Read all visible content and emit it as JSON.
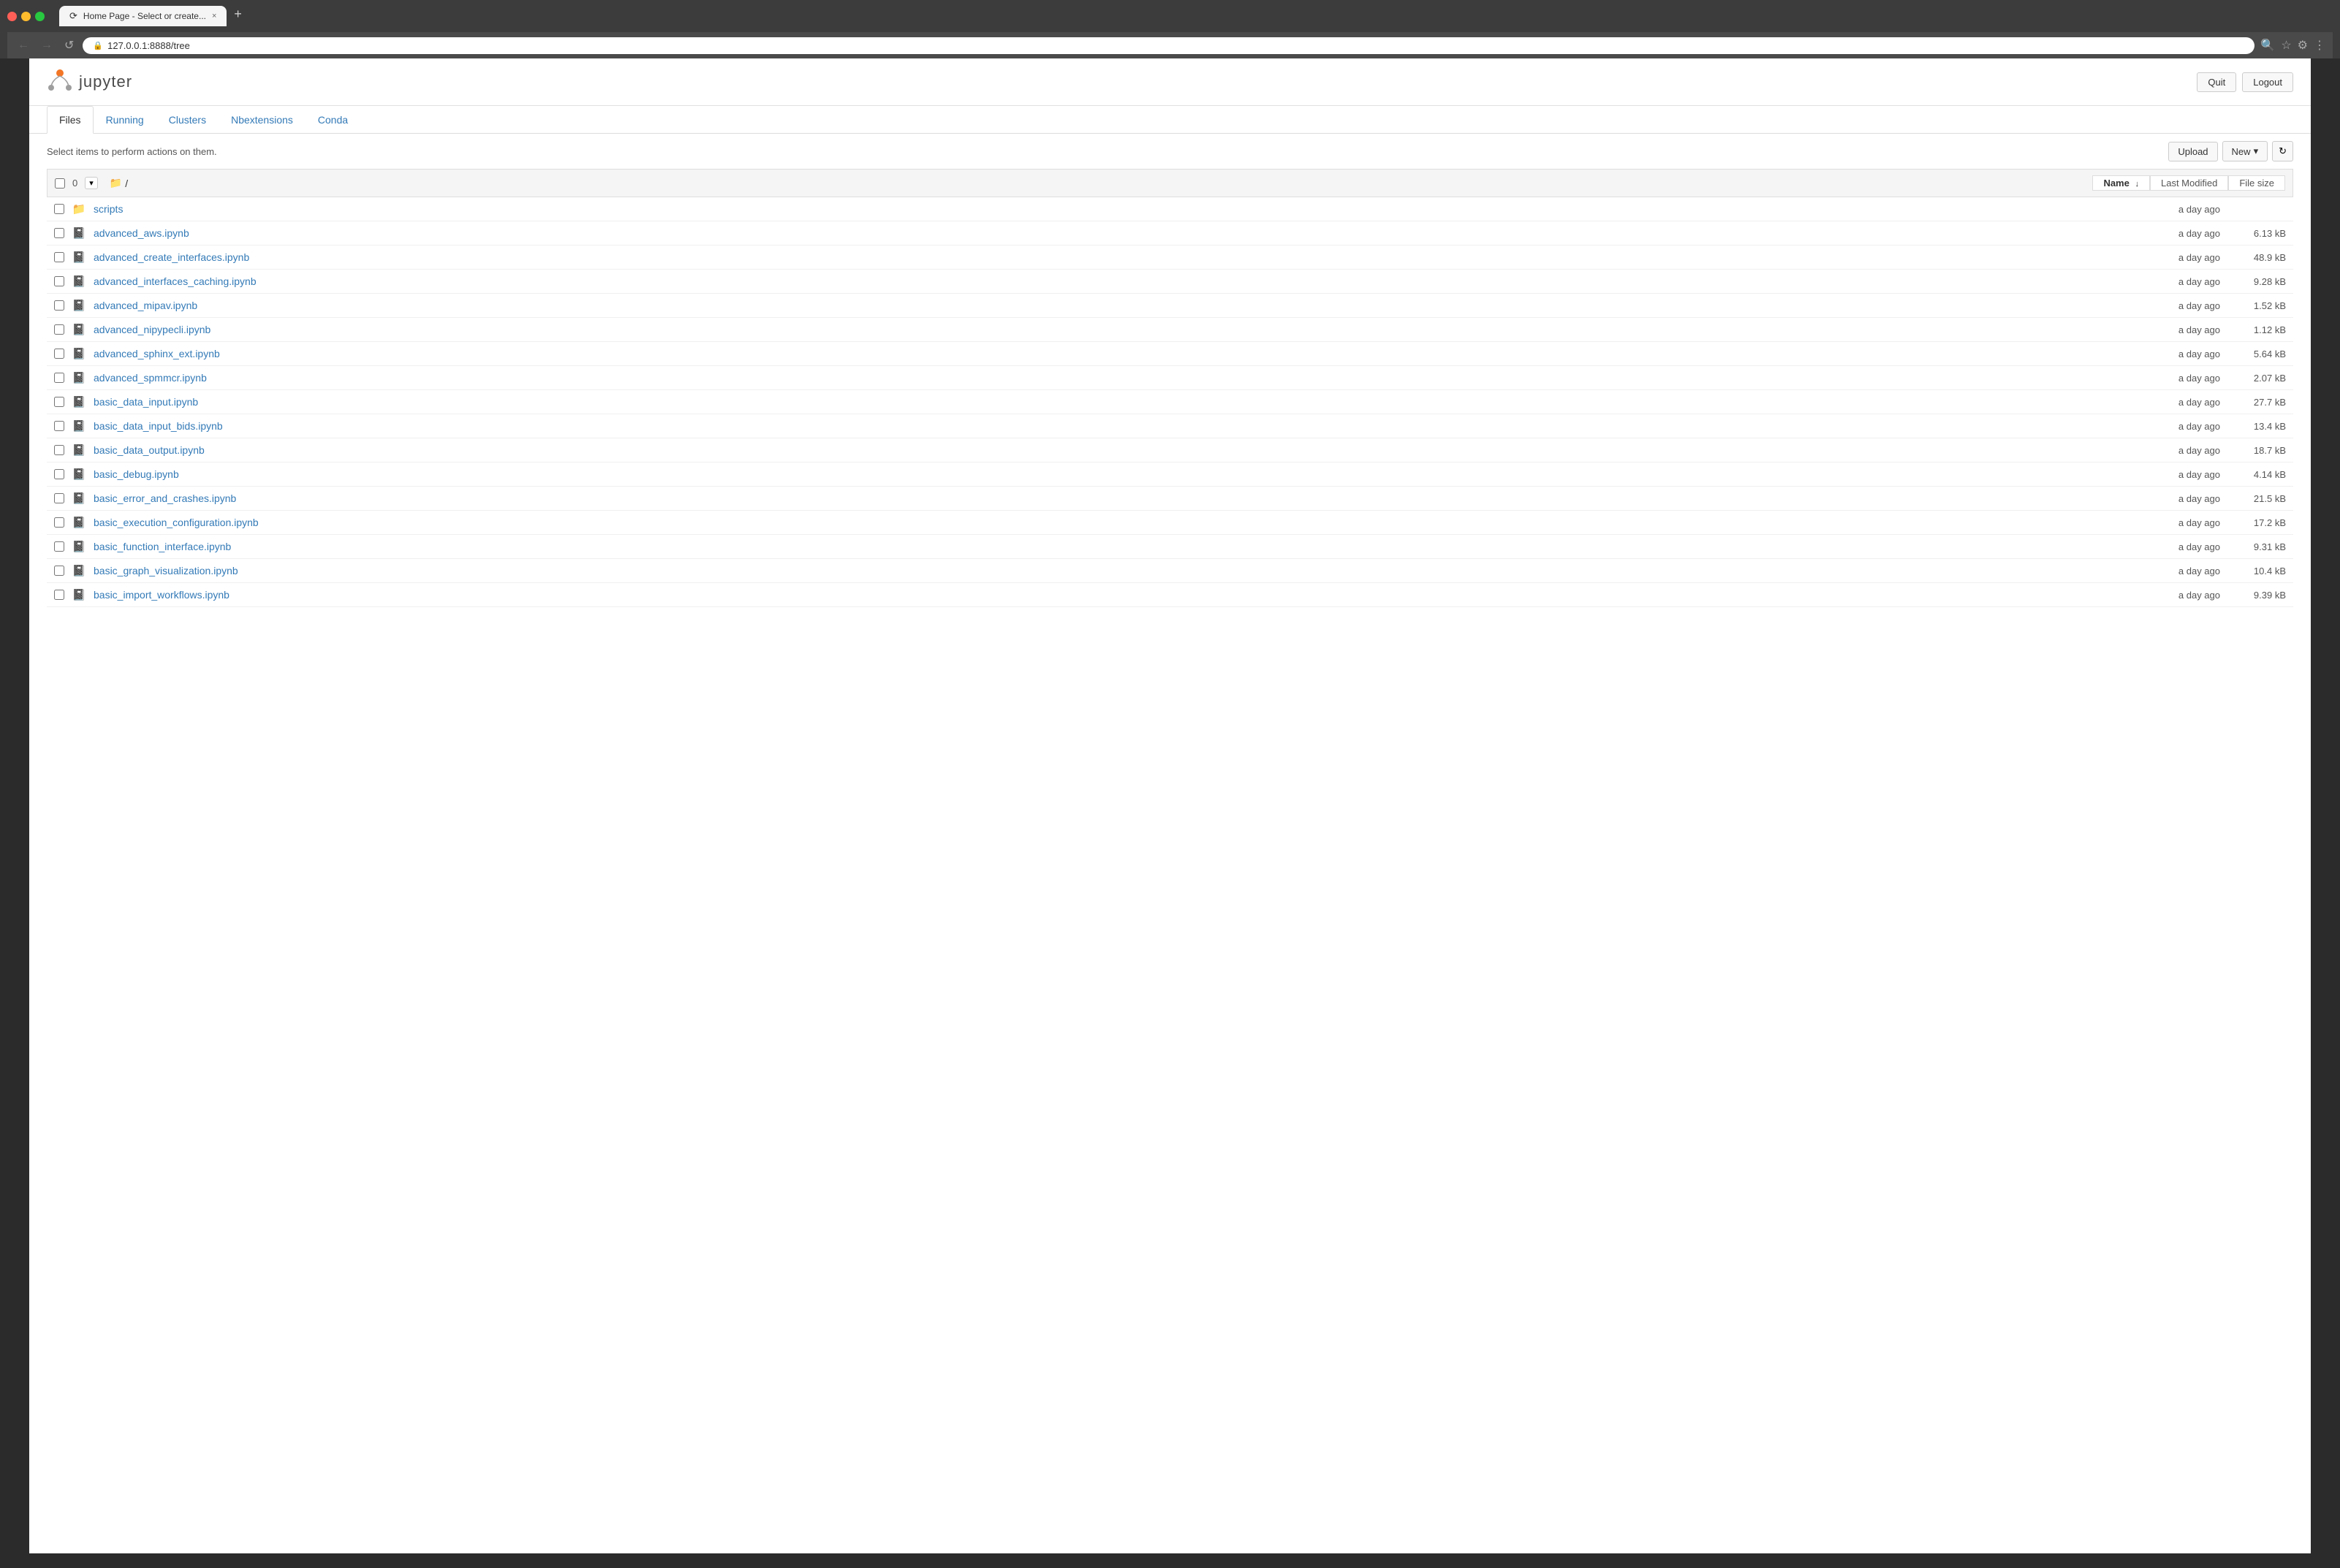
{
  "browser": {
    "tab_title": "Home Page - Select or create...",
    "tab_close": "×",
    "tab_new": "+",
    "address": "127.0.0.1:8888/tree",
    "nav_back": "←",
    "nav_forward": "→",
    "nav_refresh": "↺"
  },
  "header": {
    "logo_text": "jupyter",
    "quit_label": "Quit",
    "logout_label": "Logout"
  },
  "tabs": [
    {
      "id": "files",
      "label": "Files",
      "active": true
    },
    {
      "id": "running",
      "label": "Running",
      "active": false
    },
    {
      "id": "clusters",
      "label": "Clusters",
      "active": false
    },
    {
      "id": "nbextensions",
      "label": "Nbextensions",
      "active": false
    },
    {
      "id": "conda",
      "label": "Conda",
      "active": false
    }
  ],
  "toolbar": {
    "select_info": "Select items to perform actions on them.",
    "upload_label": "Upload",
    "new_label": "New",
    "new_caret": "▾",
    "refresh_icon": "↻"
  },
  "file_list": {
    "item_count": "0",
    "breadcrumb_folder_icon": "📁",
    "breadcrumb_path": "/",
    "col_name": "Name",
    "col_name_sort": "↓",
    "col_last_modified": "Last Modified",
    "col_file_size": "File size",
    "files": [
      {
        "name": "scripts",
        "type": "folder",
        "modified": "a day ago",
        "size": ""
      },
      {
        "name": "advanced_aws.ipynb",
        "type": "notebook",
        "modified": "a day ago",
        "size": "6.13 kB"
      },
      {
        "name": "advanced_create_interfaces.ipynb",
        "type": "notebook",
        "modified": "a day ago",
        "size": "48.9 kB"
      },
      {
        "name": "advanced_interfaces_caching.ipynb",
        "type": "notebook",
        "modified": "a day ago",
        "size": "9.28 kB"
      },
      {
        "name": "advanced_mipav.ipynb",
        "type": "notebook",
        "modified": "a day ago",
        "size": "1.52 kB"
      },
      {
        "name": "advanced_nipypecli.ipynb",
        "type": "notebook",
        "modified": "a day ago",
        "size": "1.12 kB"
      },
      {
        "name": "advanced_sphinx_ext.ipynb",
        "type": "notebook",
        "modified": "a day ago",
        "size": "5.64 kB"
      },
      {
        "name": "advanced_spmmcr.ipynb",
        "type": "notebook",
        "modified": "a day ago",
        "size": "2.07 kB"
      },
      {
        "name": "basic_data_input.ipynb",
        "type": "notebook",
        "modified": "a day ago",
        "size": "27.7 kB"
      },
      {
        "name": "basic_data_input_bids.ipynb",
        "type": "notebook",
        "modified": "a day ago",
        "size": "13.4 kB"
      },
      {
        "name": "basic_data_output.ipynb",
        "type": "notebook",
        "modified": "a day ago",
        "size": "18.7 kB"
      },
      {
        "name": "basic_debug.ipynb",
        "type": "notebook",
        "modified": "a day ago",
        "size": "4.14 kB"
      },
      {
        "name": "basic_error_and_crashes.ipynb",
        "type": "notebook",
        "modified": "a day ago",
        "size": "21.5 kB"
      },
      {
        "name": "basic_execution_configuration.ipynb",
        "type": "notebook",
        "modified": "a day ago",
        "size": "17.2 kB"
      },
      {
        "name": "basic_function_interface.ipynb",
        "type": "notebook",
        "modified": "a day ago",
        "size": "9.31 kB"
      },
      {
        "name": "basic_graph_visualization.ipynb",
        "type": "notebook",
        "modified": "a day ago",
        "size": "10.4 kB"
      },
      {
        "name": "basic_import_workflows.ipynb",
        "type": "notebook",
        "modified": "a day ago",
        "size": "9.39 kB"
      }
    ]
  }
}
